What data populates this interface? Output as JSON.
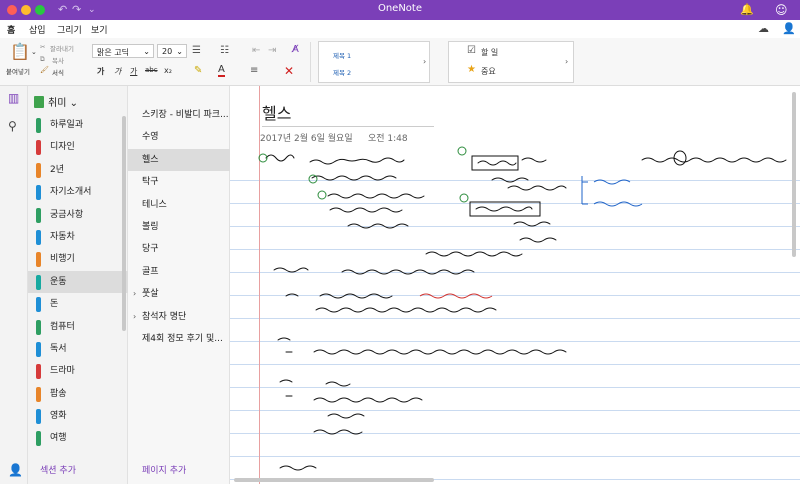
{
  "app": {
    "title": "OneNote"
  },
  "menu": {
    "tabs": [
      "홈",
      "삽입",
      "그리기",
      "보기"
    ]
  },
  "ribbon": {
    "paste_label": "붙여넣기",
    "cut_label": "잘라내기",
    "copy_label": "복사",
    "format_label": "서식",
    "tooltip": "복사",
    "font_name": "맑은 고딕",
    "font_size": "20",
    "bold": "가",
    "italic": "가",
    "underline": "가",
    "strike": "abc",
    "subscript": "x₂",
    "styles": [
      "제목 1",
      "제목 2"
    ],
    "tags": [
      "할 일",
      "중요"
    ]
  },
  "notebook": {
    "name": "취미"
  },
  "sections": [
    {
      "label": "하루일과",
      "color": "#2e9e62"
    },
    {
      "label": "디자인",
      "color": "#d63b3b"
    },
    {
      "label": "2년",
      "color": "#e8852a"
    },
    {
      "label": "자기소개서",
      "color": "#1f8fd6"
    },
    {
      "label": "궁금사항",
      "color": "#2e9e62"
    },
    {
      "label": "자동차",
      "color": "#1f8fd6"
    },
    {
      "label": "비행기",
      "color": "#e8852a"
    },
    {
      "label": "운동",
      "color": "#17a9a0"
    },
    {
      "label": "돈",
      "color": "#1f8fd6"
    },
    {
      "label": "컴퓨터",
      "color": "#2e9e62"
    },
    {
      "label": "독서",
      "color": "#1f8fd6"
    },
    {
      "label": "드라마",
      "color": "#d63b3b"
    },
    {
      "label": "팝송",
      "color": "#e8852a"
    },
    {
      "label": "영화",
      "color": "#1f8fd6"
    },
    {
      "label": "여행",
      "color": "#2e9e62"
    }
  ],
  "add_section": "섹션 추가",
  "pages": [
    {
      "label": "스키장 - 비발디 파크...",
      "chev": ""
    },
    {
      "label": "수영",
      "chev": ""
    },
    {
      "label": "헬스",
      "chev": ""
    },
    {
      "label": "탁구",
      "chev": ""
    },
    {
      "label": "테니스",
      "chev": ""
    },
    {
      "label": "볼링",
      "chev": ""
    },
    {
      "label": "당구",
      "chev": ""
    },
    {
      "label": "골프",
      "chev": ""
    },
    {
      "label": "풋살",
      "chev": "›"
    },
    {
      "label": "참석자 명단",
      "chev": "›"
    },
    {
      "label": "제4회 정모 후기 및...",
      "chev": ""
    }
  ],
  "add_page": "페이지 추가",
  "page": {
    "title": "헬스",
    "date": "2017년 2월 6일 월요일",
    "time": "오전 1:48"
  },
  "colors": {
    "accent": "#7b3fb8"
  }
}
